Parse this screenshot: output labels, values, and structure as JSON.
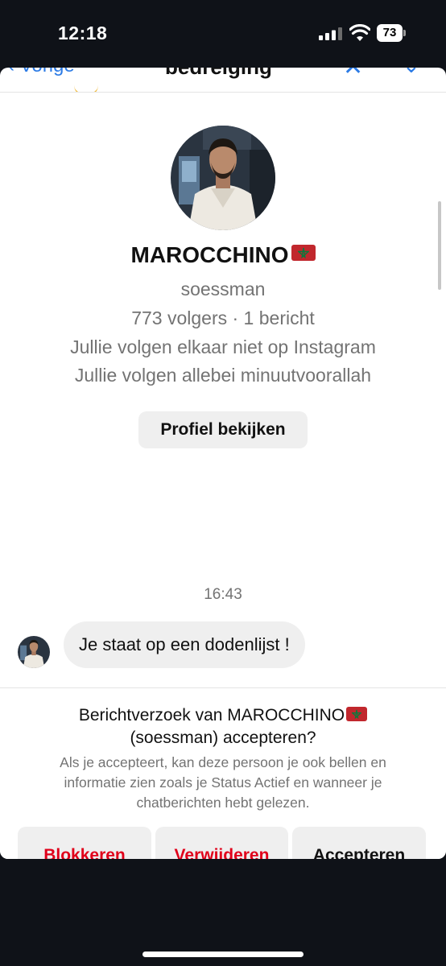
{
  "status_bar": {
    "time": "12:18",
    "battery": "73"
  },
  "nav": {
    "back_label": "Vorige",
    "title": "bedreiging",
    "icons": [
      "chevron-left-icon",
      "close-icon",
      "chevron-down-icon"
    ]
  },
  "profile": {
    "name": "MAROCCHINO",
    "name_flag": "morocco-flag",
    "username": "soessman",
    "stats": "773 volgers · 1 bericht",
    "follow_status": "Jullie volgen elkaar niet op Instagram",
    "mutual": "Jullie volgen allebei minuutvoorallah",
    "view_profile_label": "Profiel bekijken"
  },
  "conversation": {
    "timestamp": "16:43",
    "messages": [
      {
        "text": "Je staat op een dodenlijst !"
      }
    ]
  },
  "request": {
    "title_line1": "Berichtverzoek van MAROCCHINO",
    "title_line2": "(soessman) accepteren?",
    "description": "Als je accepteert, kan deze persoon je ook bellen en informatie zien zoals je Status Actief en wanneer je chatberichten hebt gelezen.",
    "buttons": {
      "block": "Blokkeren",
      "delete": "Verwijderen",
      "accept": "Accepteren"
    }
  },
  "colors": {
    "accent": "#2c7be5",
    "danger": "#e0001a",
    "secondary_text": "#737373",
    "button_bg": "#efefef"
  }
}
